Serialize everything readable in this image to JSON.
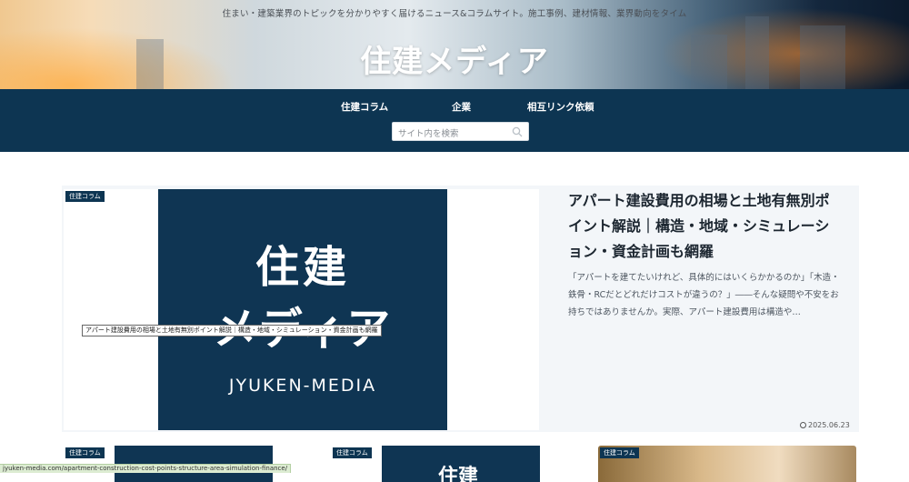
{
  "header": {
    "tagline": "住まい・建築業界のトピックを分かりやすく届けるニュース&コラムサイト。施工事例、建材情報、業界動向をタイム",
    "logo_text": "住建メディア"
  },
  "nav": {
    "items": [
      {
        "label": "住建コラム"
      },
      {
        "label": "企業"
      },
      {
        "label": "相互リンク依頼"
      }
    ],
    "search_placeholder": "サイト内を検索"
  },
  "featured": {
    "category": "住建コラム",
    "thumb_logo_line1": "住建",
    "thumb_logo_line2": "メディア",
    "thumb_logo_en": "JYUKEN-MEDIA",
    "tooltip": "アパート建設費用の相場と土地有無別ポイント解説｜構造・地域・シミュレーション・資金計画も網羅",
    "title": "アパート建設費用の相場と土地有無別ポイント解説｜構造・地域・シミュレーション・資金計画も網羅",
    "excerpt": "「アパートを建てたいけれど、具体的にはいくらかかるのか」「木造・鉄骨・RCだとどれだけコストが違うの？」――そんな疑問や不安をお持ちではありませんか。実際、アパート建設費用は構造や…",
    "date": "2025.06.23"
  },
  "cards": [
    {
      "category": "住建コラム",
      "peek": ""
    },
    {
      "category": "住建コラム",
      "peek": "住建"
    },
    {
      "category": "住建コラム",
      "peek": ""
    }
  ],
  "status_url": "jyuken-media.com/apartment-construction-cost-points-structure-area-simulation-finance/",
  "colors": {
    "navy": "#0d3552",
    "accent": "#0f3553"
  }
}
